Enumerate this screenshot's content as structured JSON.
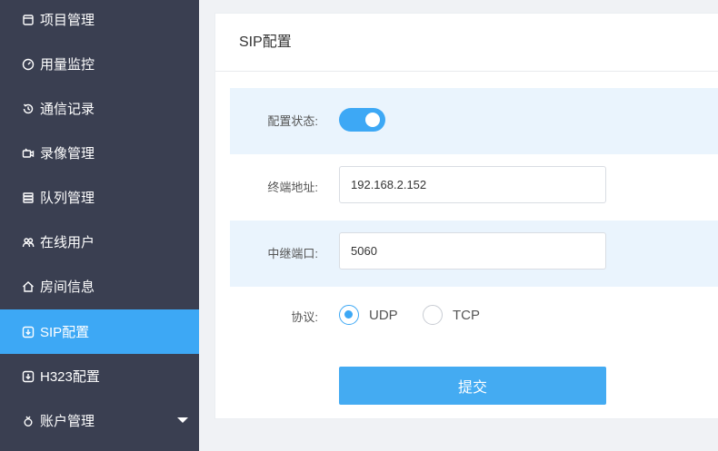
{
  "sidebar": {
    "items": [
      {
        "label": "项目管理",
        "icon": "project-icon"
      },
      {
        "label": "用量监控",
        "icon": "gauge-icon"
      },
      {
        "label": "通信记录",
        "icon": "history-icon"
      },
      {
        "label": "录像管理",
        "icon": "video-icon"
      },
      {
        "label": "队列管理",
        "icon": "queue-icon"
      },
      {
        "label": "在线用户",
        "icon": "users-icon"
      },
      {
        "label": "房间信息",
        "icon": "home-icon"
      },
      {
        "label": "SIP配置",
        "icon": "download-icon",
        "active": true
      },
      {
        "label": "H323配置",
        "icon": "download-icon"
      },
      {
        "label": "账户管理",
        "icon": "account-icon",
        "has_submenu": true
      }
    ]
  },
  "card": {
    "title": "SIP配置"
  },
  "form": {
    "status_label": "配置状态:",
    "status_on": true,
    "address_label": "终端地址:",
    "address_value": "192.168.2.152",
    "port_label": "中继端口:",
    "port_value": "5060",
    "protocol_label": "协议:",
    "protocol_options": [
      "UDP",
      "TCP"
    ],
    "protocol_selected": "UDP",
    "submit_label": "提交"
  },
  "colors": {
    "accent": "#3da8f5",
    "sidebar_bg": "#3a3f51",
    "row_highlight": "#eaf4fd"
  }
}
